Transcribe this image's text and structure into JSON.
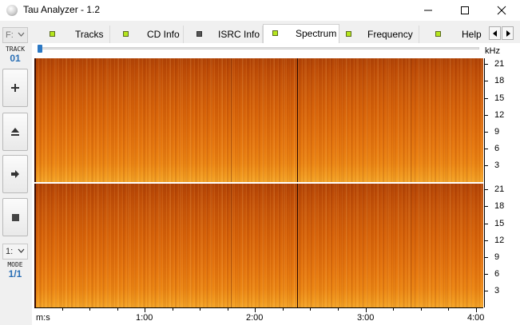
{
  "window": {
    "title": "Tau Analyzer - 1.2"
  },
  "sidebar": {
    "drive_value": "F:",
    "track_label": "TRACK",
    "track_number": "01",
    "mode_select_value": "1:",
    "mode_label": "MODE",
    "mode_value": "1/1"
  },
  "tabs": [
    {
      "label": "Tracks",
      "led": "green"
    },
    {
      "label": "CD Info",
      "led": "green"
    },
    {
      "label": "ISRC Info",
      "led": "dark"
    },
    {
      "label": "Spectrum",
      "led": "green",
      "active": true
    },
    {
      "label": "Frequency",
      "led": "green"
    },
    {
      "label": "Help",
      "led": "green"
    }
  ],
  "spectrum": {
    "freq_unit": "kHz",
    "freq_ticks": [
      "21",
      "18",
      "15",
      "12",
      "9",
      "6",
      "3"
    ],
    "time_unit": "m:s",
    "time_ticks": [
      "1:00",
      "2:00",
      "3:00",
      "4:00"
    ],
    "position_fraction": 0.0
  },
  "colors": {
    "led_green": "#b5e61d",
    "slider_thumb": "#2b78c4",
    "spectrum_low": "#f4a529",
    "spectrum_high": "#b14406"
  },
  "icons": [
    "app-icon",
    "minimize-icon",
    "maximize-icon",
    "close-icon",
    "plus-icon",
    "eject-icon",
    "arrow-right-icon",
    "stop-icon",
    "chevron-left-icon",
    "chevron-right-icon"
  ]
}
